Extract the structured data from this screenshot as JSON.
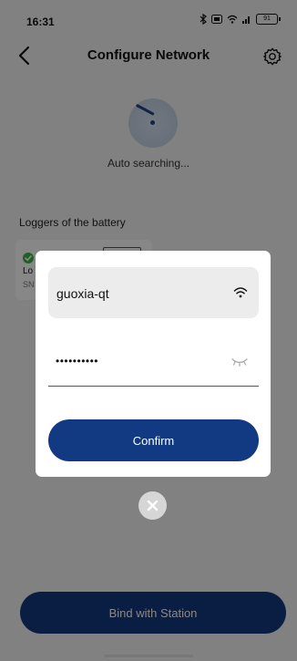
{
  "status_bar": {
    "time": "16:31",
    "battery": "91"
  },
  "header": {
    "title": "Configure Network"
  },
  "search": {
    "status": "Auto searching..."
  },
  "loggers": {
    "section_title": "Loggers of the battery",
    "items": [
      {
        "name_partial": "Lo",
        "sn_partial": "SN"
      }
    ]
  },
  "dialog": {
    "ssid": "guoxia-qt",
    "password_masked": "••••••••••",
    "confirm_label": "Confirm"
  },
  "footer": {
    "bind_label": "Bind with Station"
  },
  "icons": {
    "back": "back-arrow-icon",
    "settings": "gear-icon",
    "wifi": "wifi-icon",
    "password_visibility": "eye-closed-icon",
    "close": "close-icon",
    "check": "check-icon"
  },
  "colors": {
    "primary": "#123a82",
    "overlay": "#000000",
    "success": "#3bb54a"
  }
}
